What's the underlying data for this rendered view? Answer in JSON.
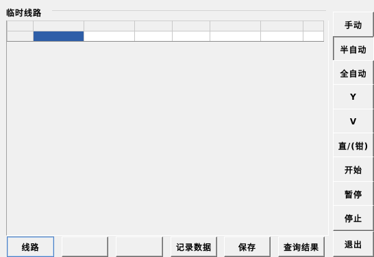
{
  "panel": {
    "title": "临时线路"
  },
  "grid": {
    "columns": 8,
    "selected_cell": {
      "row": 1,
      "col": 2
    }
  },
  "side_buttons": [
    {
      "label": "手动",
      "pressed": false
    },
    {
      "label": "半自动",
      "pressed": true
    },
    {
      "label": "全自动",
      "pressed": false
    },
    {
      "label": "Y",
      "pressed": false
    },
    {
      "label": "V",
      "pressed": false
    },
    {
      "label": "直/(钳)",
      "pressed": false
    },
    {
      "label": "开始",
      "pressed": false
    },
    {
      "label": "暂停",
      "pressed": false
    },
    {
      "label": "停止",
      "pressed": false
    }
  ],
  "exit_button": {
    "label": "退出"
  },
  "bottom_buttons": [
    {
      "label": "线路",
      "active": true
    },
    {
      "label": "",
      "active": false
    },
    {
      "label": "",
      "active": false
    },
    {
      "label": "记录数据",
      "active": false
    },
    {
      "label": "保存",
      "active": false
    },
    {
      "label": "查询结果",
      "active": false
    }
  ]
}
